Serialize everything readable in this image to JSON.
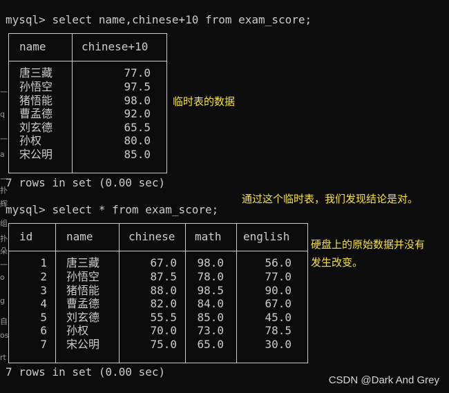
{
  "query1": {
    "prompt": "mysql>",
    "sql": "select name,chinese+10 from exam_score;",
    "headers": [
      "name",
      "chinese+10"
    ],
    "rows": [
      [
        "唐三藏",
        "77.0"
      ],
      [
        "孙悟空",
        "97.5"
      ],
      [
        "猪悟能",
        "98.0"
      ],
      [
        "曹孟德",
        "92.0"
      ],
      [
        "刘玄德",
        "65.5"
      ],
      [
        "孙权",
        "80.0"
      ],
      [
        "宋公明",
        "85.0"
      ]
    ],
    "result": "7 rows in set (0.00 sec)"
  },
  "query2": {
    "prompt": "mysql>",
    "sql": "select * from exam_score;",
    "headers": [
      "id",
      "name",
      "chinese",
      "math",
      "english"
    ],
    "rows": [
      [
        "1",
        "唐三藏",
        "67.0",
        "98.0",
        "56.0"
      ],
      [
        "2",
        "孙悟空",
        "87.5",
        "78.0",
        "77.0"
      ],
      [
        "3",
        "猪悟能",
        "88.0",
        "98.5",
        "90.0"
      ],
      [
        "4",
        "曹孟德",
        "82.0",
        "84.0",
        "67.0"
      ],
      [
        "5",
        "刘玄德",
        "55.5",
        "85.0",
        "45.0"
      ],
      [
        "6",
        "孙权",
        "70.0",
        "73.0",
        "78.5"
      ],
      [
        "7",
        "宋公明",
        "75.0",
        "65.0",
        "30.0"
      ]
    ],
    "result": "7 rows in set (0.00 sec)"
  },
  "annotations": {
    "temp_table": "临时表的数据",
    "conclusion": "通过这个临时表，我们发现结论是对。",
    "disk_line1": "硬盘上的原始数据并没有",
    "disk_line2": "发生改变。"
  },
  "watermark": "CSDN @Dark And Grey",
  "colors": {
    "background": "#0c0c0c",
    "text": "#cccccc",
    "annotation": "#f5e23b"
  }
}
